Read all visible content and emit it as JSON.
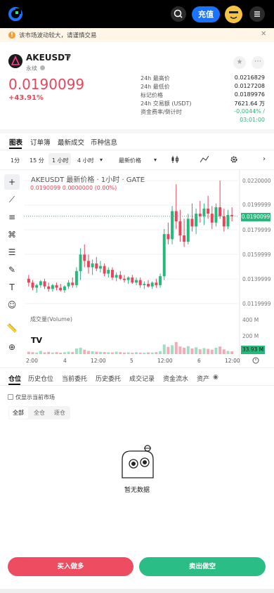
{
  "header": {
    "deposit_label": "充值"
  },
  "notice": {
    "text": "该市场波动较大，请谨慎交易",
    "icon": "alert-icon",
    "close_icon": "close-icon"
  },
  "market": {
    "symbol": "AKEUSDT",
    "type": "永续",
    "last_price": "0.0190099",
    "change_pct": "+43.91%",
    "stats": [
      {
        "label": "24h 最高价",
        "value": "0.0216829"
      },
      {
        "label": "24h 最低价",
        "value": "0.0127208"
      },
      {
        "label": "标记价格",
        "value": "0.0189976"
      },
      {
        "label": "24h 交易额 (USDT)",
        "value": "7621.64 万"
      },
      {
        "label": "资金费率/倒计时",
        "value": "-0.0044% /"
      },
      {
        "label": "",
        "value": "03:01:00"
      }
    ]
  },
  "tabs": [
    "图表",
    "订单簿",
    "最新成交",
    "币种信息"
  ],
  "intervals": [
    "1分",
    "15 分",
    "1 小时",
    "4 小时",
    "最新价格"
  ],
  "chart": {
    "title": "AKEUSDT 最新价格 · 1小时 · GATE",
    "ohlc": "0.0190099  0.0000000  (0.00%)",
    "volume_label": "成交量(Volume)",
    "price_tag": "0.0190099",
    "volume_tag": "33.93 M",
    "y_ticks": [
      "0.0220000",
      "0.0199999",
      "0.0179999",
      "0.0159999",
      "0.0139999",
      "0.0119999"
    ],
    "vol_ticks": [
      "400 M",
      "200 M"
    ],
    "x_ticks": [
      "2:00",
      "4",
      "12:00",
      "5",
      "12:00",
      "6",
      "12:00"
    ],
    "tv_logo": "TV"
  },
  "chart_data": {
    "type": "candlestick",
    "title": "AKEUSDT 最新价格 · 1小时 · GATE",
    "ylim": [
      0.0115,
      0.0224
    ],
    "series": [
      {
        "name": "price",
        "values": [
          [
            0.0141,
            0.0144,
            0.0135,
            0.0138
          ],
          [
            0.0138,
            0.014,
            0.0132,
            0.0134
          ],
          [
            0.0134,
            0.0137,
            0.013,
            0.0136
          ],
          [
            0.0136,
            0.014,
            0.0134,
            0.0139
          ],
          [
            0.0139,
            0.0141,
            0.0133,
            0.0135
          ],
          [
            0.0135,
            0.0138,
            0.0131,
            0.0133
          ],
          [
            0.0133,
            0.0137,
            0.0131,
            0.0136
          ],
          [
            0.0136,
            0.0138,
            0.0132,
            0.0134
          ],
          [
            0.0134,
            0.0137,
            0.0131,
            0.0132
          ],
          [
            0.0132,
            0.0136,
            0.013,
            0.0135
          ],
          [
            0.0135,
            0.014,
            0.0133,
            0.0138
          ],
          [
            0.0138,
            0.0142,
            0.0134,
            0.0136
          ],
          [
            0.0136,
            0.015,
            0.0134,
            0.0147
          ],
          [
            0.0147,
            0.0165,
            0.014,
            0.016
          ],
          [
            0.016,
            0.0168,
            0.015,
            0.0155
          ],
          [
            0.0155,
            0.016,
            0.0145,
            0.015
          ],
          [
            0.015,
            0.0156,
            0.0144,
            0.0153
          ],
          [
            0.0153,
            0.0158,
            0.0147,
            0.0149
          ],
          [
            0.0149,
            0.0155,
            0.0146,
            0.0151
          ],
          [
            0.0151,
            0.0153,
            0.0143,
            0.0145
          ],
          [
            0.0145,
            0.015,
            0.0142,
            0.0148
          ],
          [
            0.0148,
            0.015,
            0.014,
            0.0142
          ],
          [
            0.0142,
            0.0146,
            0.0139,
            0.0144
          ],
          [
            0.0144,
            0.0147,
            0.014,
            0.0141
          ],
          [
            0.0141,
            0.0144,
            0.0138,
            0.014
          ],
          [
            0.014,
            0.0143,
            0.0137,
            0.0142
          ],
          [
            0.0142,
            0.0144,
            0.0137,
            0.0138
          ],
          [
            0.0138,
            0.0142,
            0.0136,
            0.014
          ],
          [
            0.014,
            0.0142,
            0.0134,
            0.0136
          ],
          [
            0.0136,
            0.0139,
            0.0133,
            0.0137
          ],
          [
            0.0137,
            0.014,
            0.0134,
            0.0135
          ],
          [
            0.0135,
            0.0139,
            0.0133,
            0.0138
          ],
          [
            0.0138,
            0.0141,
            0.0134,
            0.0136
          ],
          [
            0.0136,
            0.0145,
            0.0134,
            0.0143
          ],
          [
            0.0143,
            0.018,
            0.014,
            0.0176
          ],
          [
            0.0176,
            0.0185,
            0.0168,
            0.0172
          ],
          [
            0.0172,
            0.0198,
            0.0168,
            0.0194
          ],
          [
            0.0194,
            0.0215,
            0.018,
            0.0186
          ],
          [
            0.0186,
            0.0195,
            0.017,
            0.0175
          ],
          [
            0.0175,
            0.0188,
            0.0166,
            0.017
          ],
          [
            0.017,
            0.0192,
            0.0168,
            0.0188
          ],
          [
            0.0188,
            0.02,
            0.0178,
            0.0182
          ],
          [
            0.0182,
            0.0196,
            0.0176,
            0.0192
          ],
          [
            0.0192,
            0.0202,
            0.0185,
            0.019
          ],
          [
            0.019,
            0.02,
            0.0183,
            0.0196
          ],
          [
            0.0196,
            0.0206,
            0.0188,
            0.0192
          ],
          [
            0.0192,
            0.0198,
            0.018,
            0.0185
          ],
          [
            0.0185,
            0.02,
            0.0182,
            0.0197
          ],
          [
            0.0197,
            0.0218,
            0.0188,
            0.019
          ],
          [
            0.019,
            0.0196,
            0.0178,
            0.0182
          ],
          [
            0.0182,
            0.0195,
            0.018,
            0.0191
          ],
          [
            0.0191,
            0.0197,
            0.0186,
            0.019
          ]
        ]
      }
    ]
  },
  "position_tabs": [
    "仓位",
    "历史仓位",
    "当前委托",
    "历史委托",
    "成交记录",
    "资金流水",
    "资产"
  ],
  "filter_label": "仅显示当前市场",
  "segments": [
    "全部",
    "全仓",
    "逐仓"
  ],
  "empty_text": "暂无数据",
  "buy_label": "买入做多",
  "sell_label": "卖出做空",
  "colors": {
    "up": "#27b97b",
    "down": "#e8455b",
    "brand": "#1a73ff"
  }
}
